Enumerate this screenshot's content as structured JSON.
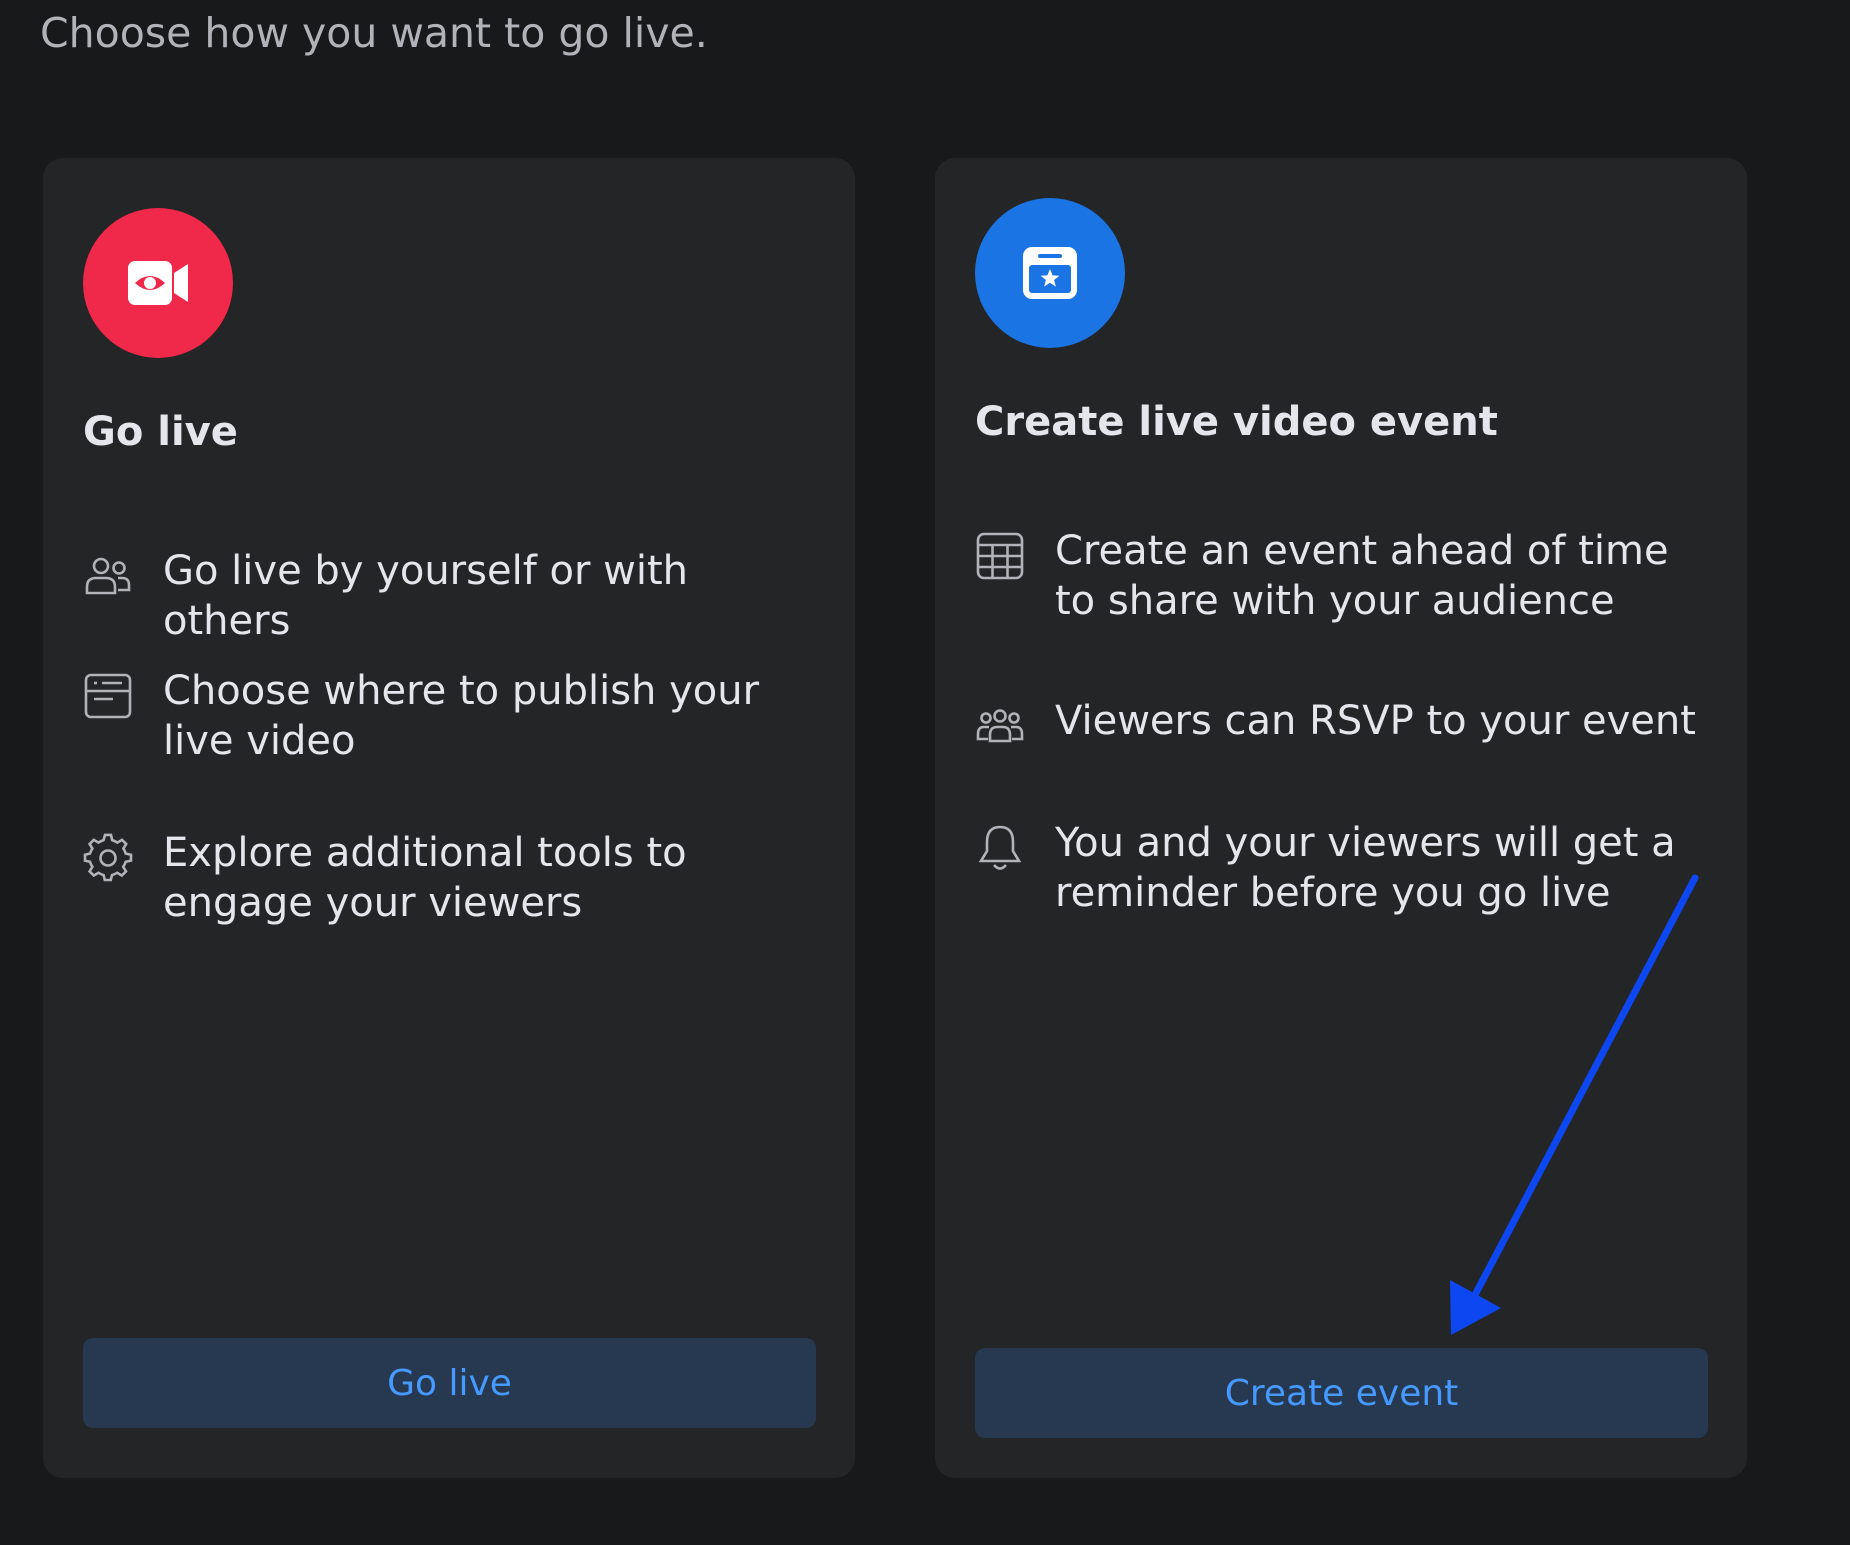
{
  "header": {
    "subtitle": "Choose how you want to go live."
  },
  "cards": [
    {
      "icon": "video-camera-icon",
      "accent": "#f02849",
      "title": "Go live",
      "features": [
        {
          "icon": "people-icon",
          "text": "Go live by yourself or with others"
        },
        {
          "icon": "browser-window-icon",
          "text": "Choose where to publish your live video"
        },
        {
          "icon": "gear-icon",
          "text": "Explore additional tools to engage your viewers"
        }
      ],
      "button_label": "Go live"
    },
    {
      "icon": "calendar-star-icon",
      "accent": "#1b74e4",
      "title": "Create live video event",
      "features": [
        {
          "icon": "calendar-grid-icon",
          "text": "Create an event ahead of time to share with your audience"
        },
        {
          "icon": "group-icon",
          "text": "Viewers can RSVP to your event"
        },
        {
          "icon": "bell-icon",
          "text": "You and your viewers will get a reminder before you go live"
        }
      ],
      "button_label": "Create event"
    }
  ],
  "annotation": {
    "icon": "arrow-annotation-icon",
    "color": "#0d47f2"
  }
}
